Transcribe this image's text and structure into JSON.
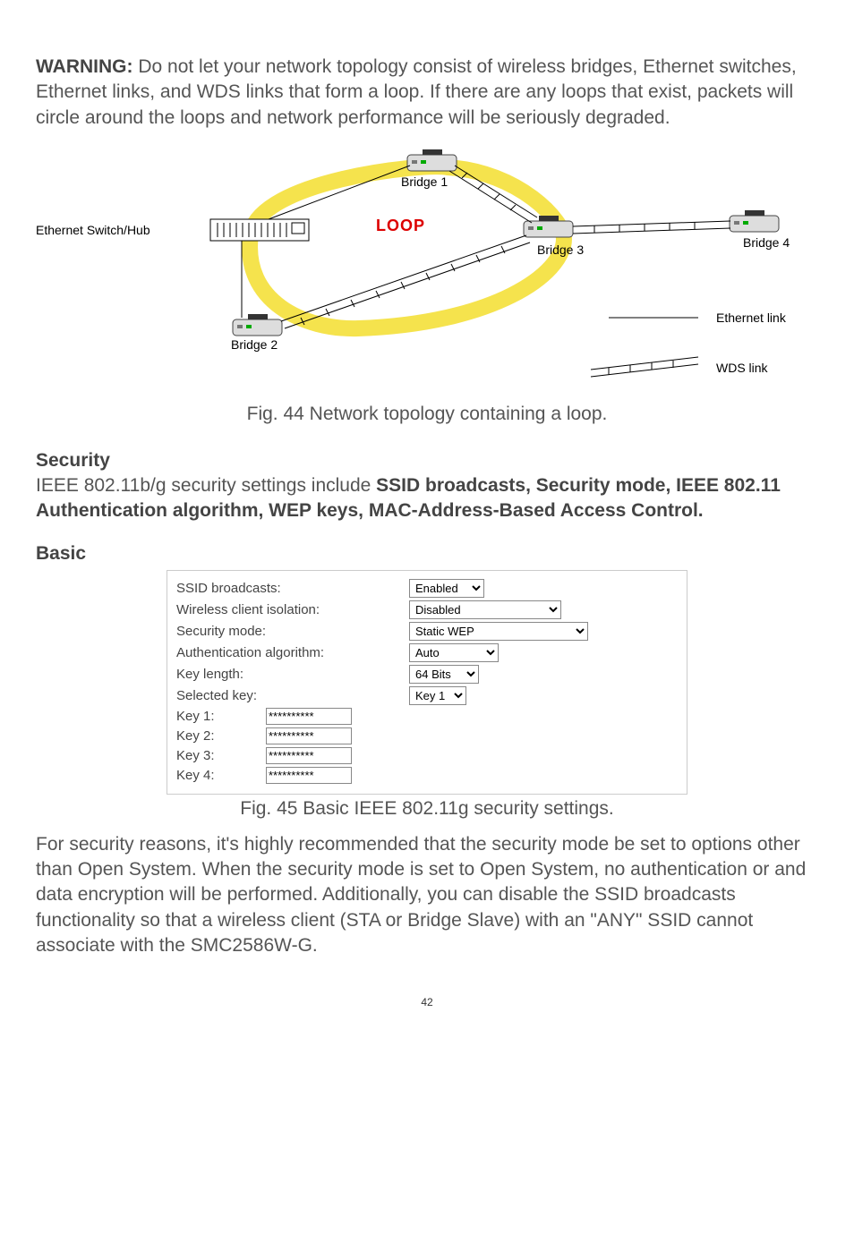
{
  "warning_label": "WARNING:",
  "warning_text": " Do not let your network topology consist of wireless bridges, Ethernet switches, Ethernet links, and WDS links that form a loop. If there are any loops that exist, packets will circle around the loops and network performance will be seriously degraded.",
  "diagram": {
    "eth_switch": "Ethernet Switch/Hub",
    "bridge1": "Bridge 1",
    "bridge2": "Bridge 2",
    "bridge3": "Bridge 3",
    "bridge4": "Bridge 4",
    "loop": "LOOP",
    "eth_link": "Ethernet link",
    "wds_link": "WDS link"
  },
  "fig44": "Fig. 44 Network topology containing a loop.",
  "security_head": "Security",
  "security_text_pre": "IEEE 802.11b/g security settings include ",
  "security_bold": "SSID broadcasts, Security mode, IEEE 802.11 Authentication algorithm, WEP keys, MAC-Address-Based Access Control.",
  "basic_head": "Basic",
  "form": {
    "ssid_label": "SSID broadcasts:",
    "ssid_value": "Enabled",
    "iso_label": "Wireless client isolation:",
    "iso_value": "Disabled",
    "sec_label": "Security mode:",
    "sec_value": "Static WEP",
    "auth_label": "Authentication algorithm:",
    "auth_value": "Auto",
    "keylen_label": "Key length:",
    "keylen_value": "64 Bits",
    "selkey_label": "Selected key:",
    "selkey_value": "Key 1",
    "key1_label": "Key 1:",
    "key2_label": "Key 2:",
    "key3_label": "Key 3:",
    "key4_label": "Key 4:",
    "key_value": "**********"
  },
  "fig45": "Fig. 45 Basic IEEE 802.11g security settings.",
  "para_after": "For security reasons, it's highly recommended that the security mode be set to options other than Open System. When the security mode is set to Open System, no authentication or and data encryption will be performed. Additionally, you can disable the SSID broadcasts functionality so that a wireless client (STA or Bridge Slave) with an \"ANY\" SSID cannot associate with the SMC2586W-G.",
  "page_num": "42"
}
